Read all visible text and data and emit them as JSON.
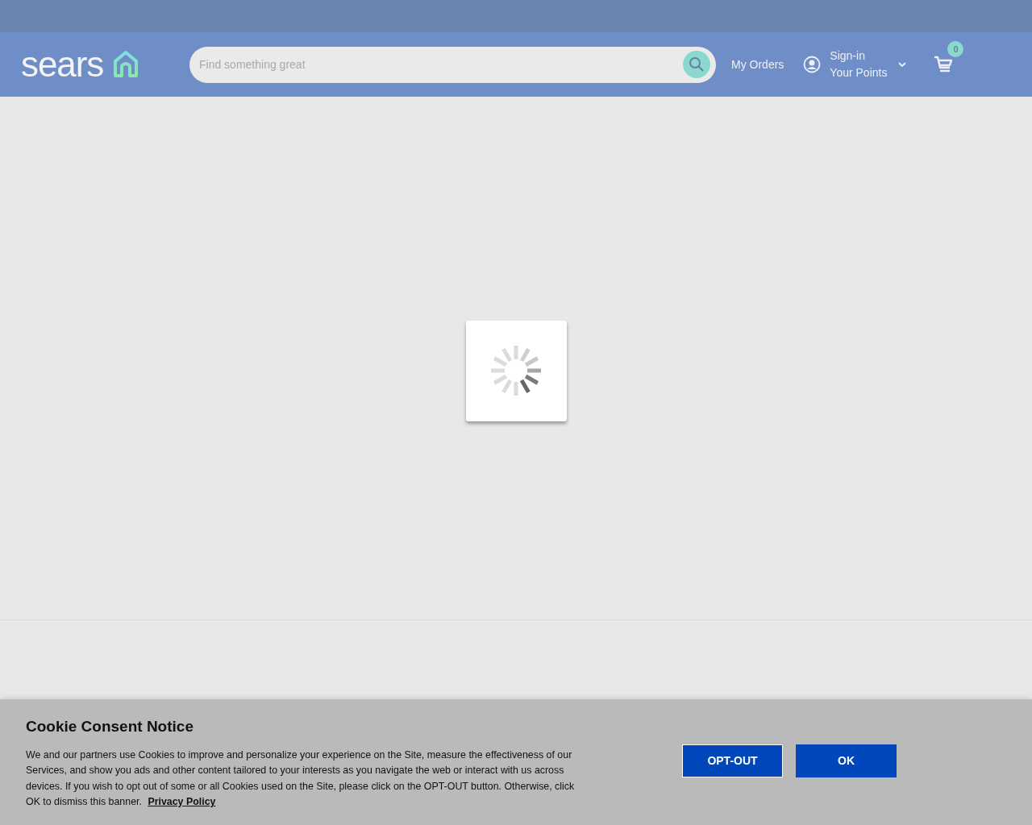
{
  "header": {
    "logo": "sears",
    "search": {
      "placeholder": "Find something great"
    },
    "my_orders": "My Orders",
    "account": {
      "line_1": "Sign-in",
      "line_2": "Your Points"
    },
    "cart": {
      "count": "0"
    }
  },
  "cookie_notice": {
    "title": "Cookie Consent Notice",
    "body": "We and our partners use Cookies to improve and personalize your experience on the Site, measure the effectiveness of our Services, and show you ads and other content tailored to your interests as you navigate the web or interact with us across devices. If you wish to opt out of some or all Cookies used on the Site, please click on the OPT-OUT button. Otherwise, click OK to dismiss this banner.",
    "link": "Privacy Policy",
    "buttons": [
      {
        "label": "OPT-OUT",
        "kind": "outline"
      },
      {
        "label": "OK",
        "kind": "filled"
      }
    ]
  }
}
